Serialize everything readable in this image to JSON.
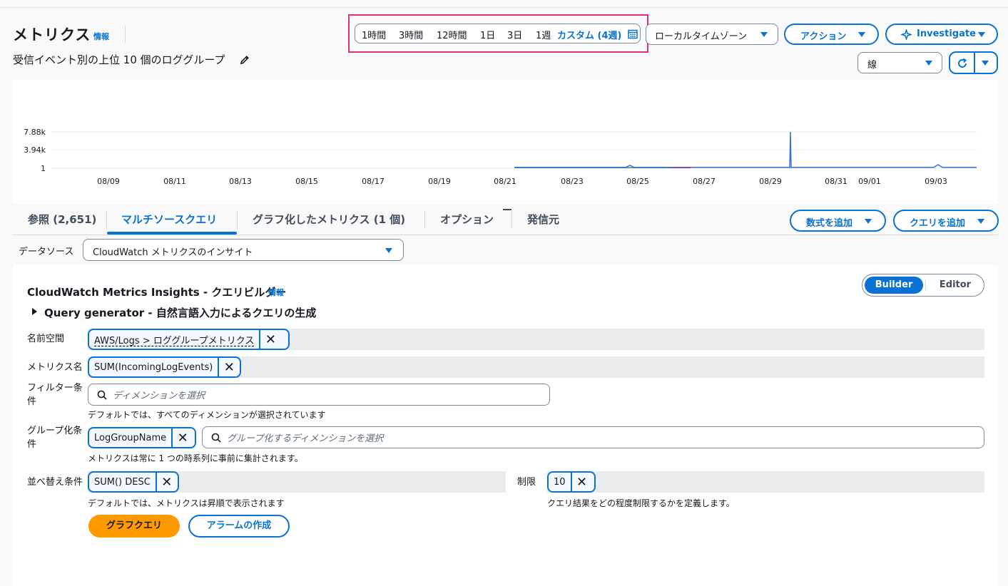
{
  "header": {
    "title": "メトリクス",
    "info": "情報",
    "subtitle": "受信イベント別の上位 10 個のロググループ"
  },
  "time_range": {
    "options": [
      "1時間",
      "3時間",
      "12時間",
      "1日",
      "3日",
      "1週"
    ],
    "active": "カスタム (4週)",
    "timezone": "ローカルタイムゾーン"
  },
  "actions": {
    "action_label": "アクション",
    "investigate_label": "Investigate",
    "chart_type": "線"
  },
  "chart_data": {
    "type": "line",
    "x_ticks": [
      "08/09",
      "08/11",
      "08/13",
      "08/15",
      "08/17",
      "08/19",
      "08/21",
      "08/23",
      "08/25",
      "08/27",
      "08/29",
      "08/31",
      "09/01",
      "09/03"
    ],
    "y_ticks": [
      "7.88k",
      "3.94k",
      "1"
    ],
    "ylim": [
      1,
      7880
    ],
    "note_spike": "08/30",
    "series_colors": [
      "#3a6fd8",
      "#e07f1f",
      "#2ea597",
      "#c33d69"
    ]
  },
  "tabs": {
    "browse": "参照 (2,651)",
    "multi": "マルチソースクエリ",
    "graphed": "グラフ化したメトリクス (1 個)",
    "options": "オプション",
    "source": "発信元",
    "add_math": "数式を追加",
    "add_query": "クエリを追加"
  },
  "datasource": {
    "label": "データソース",
    "value": "CloudWatch メトリクスのインサイト"
  },
  "builder": {
    "title": "CloudWatch Metrics Insights - クエリビルダー",
    "info": "情報",
    "mode_builder": "Builder",
    "mode_editor": "Editor",
    "generator": "Query generator - 自然言語入力によるクエリの生成",
    "namespace_label": "名前空間",
    "namespace_value": "AWS/Logs > ロググループメトリクス",
    "metric_label": "メトリクス名",
    "metric_value": "SUM(IncomingLogEvents)",
    "filter_label_1": "フィルター条",
    "filter_label_2": "件",
    "filter_placeholder": "ディメンションを選択",
    "filter_hint": "デフォルトでは、すべてのディメンションが選択されています",
    "group_label_1": "グループ化条",
    "group_label_2": "件",
    "group_value": "LogGroupName",
    "group_placeholder": "グループ化するディメンションを選択",
    "group_hint": "メトリクスは常に 1 つの時系列に事前に集計されます。",
    "order_label": "並べ替え条件",
    "order_value": "SUM() DESC",
    "order_hint": "デフォルトでは、メトリクスは昇順で表示されます",
    "limit_label": "制限",
    "limit_value": "10",
    "limit_hint": "クエリ結果をどの程度制限するかを定義します。",
    "graph_button": "グラフクエリ",
    "alarm_button": "アラームの作成"
  }
}
